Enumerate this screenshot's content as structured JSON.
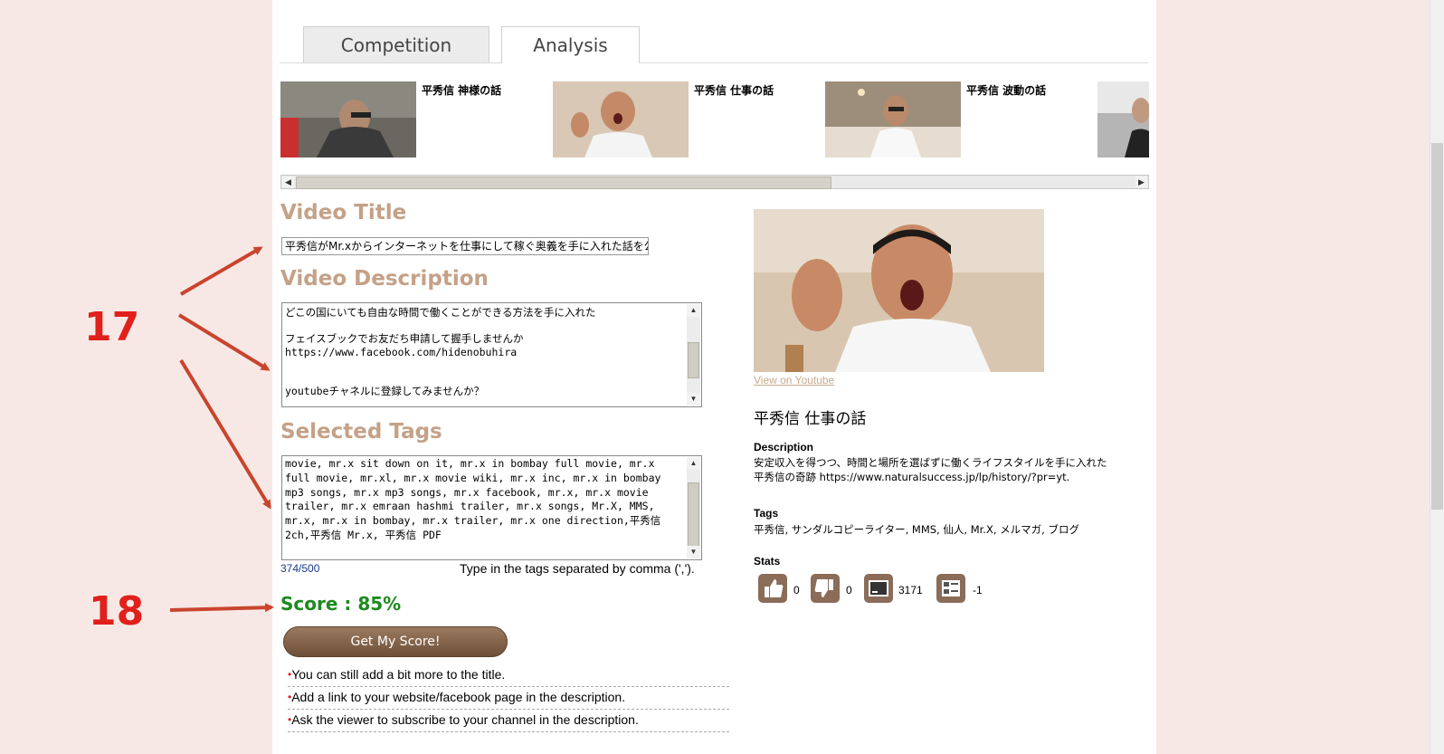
{
  "tabs": [
    {
      "label": "Competition"
    },
    {
      "label": "Analysis"
    }
  ],
  "thumbnails": [
    {
      "title": "平秀信 神様の話"
    },
    {
      "title": "平秀信 仕事の話"
    },
    {
      "title": "平秀信 波動の話"
    }
  ],
  "video_title": {
    "heading": "Video Title",
    "value": "平秀信がMr.xからインターネットを仕事にして稼ぐ奥義を手に入れた話を公開"
  },
  "video_description": {
    "heading": "Video Description",
    "value": "どこの国にいても自由な時間で働くことができる方法を手に入れた\n\nフェイスブックでお友だち申請して握手しませんか\nhttps://www.facebook.com/hidenobuhira\n\n\nyoutubeチャネルに登録してみませんか？"
  },
  "selected_tags": {
    "heading": "Selected Tags",
    "value": "movie, mr.x sit down on it, mr.x in bombay full movie, mr.x full movie, mr.xl, mr.x movie wiki, mr.x inc, mr.x in bombay mp3 songs, mr.x mp3 songs, mr.x facebook, mr.x, mr.x movie trailer, mr.x emraan hashmi trailer, mr.x songs, Mr.X, MMS, mr.x, mr.x in bombay, mr.x trailer, mr.x one direction,平秀信 2ch,平秀信 Mr.x, 平秀信 PDF",
    "count": "374/500",
    "hint": "Type in the tags separated by comma (',')."
  },
  "score": {
    "label": "Score : 85%",
    "button": "Get My Score!"
  },
  "tips": [
    "You can still add a bit more to the title.",
    "Add a link to your website/facebook page in the description.",
    "Ask the viewer to subscribe to your channel in the description."
  ],
  "selected_video": {
    "view_link": "View on Youtube",
    "title": "平秀信 仕事の話",
    "description_label": "Description",
    "description": "安定収入を得つつ、時間と場所を選ばずに働くライフスタイルを手に入れた平秀信の奇跡 https://www.naturalsuccess.jp/lp/history/?pr=yt.",
    "tags_label": "Tags",
    "tags": "平秀信, サンダルコピーライター, MMS, 仙人, Mr.X, メルマガ, ブログ",
    "stats_label": "Stats",
    "stats": {
      "likes": "0",
      "dislikes": "0",
      "views": "3171",
      "comments": "-1"
    }
  },
  "annotations": {
    "a": "17",
    "b": "18"
  },
  "colors": {
    "background": "#f8e8e5",
    "heading": "#c4a187",
    "score": "#1e8a1e",
    "annotation": "#e0201a"
  }
}
